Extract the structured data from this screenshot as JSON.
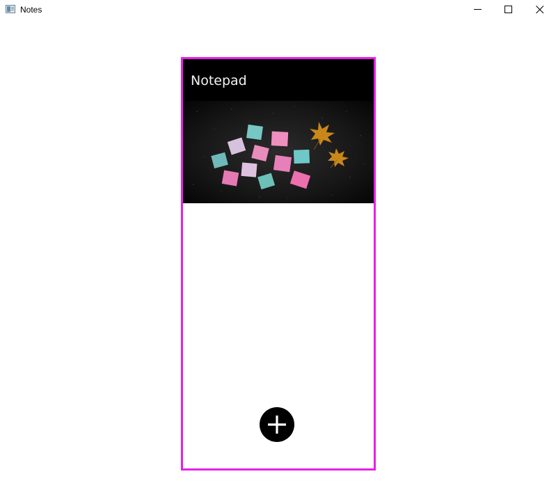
{
  "window": {
    "title": "Notes",
    "controls": {
      "minimize_icon": "minimize-icon",
      "maximize_icon": "maximize-icon",
      "close_icon": "close-icon"
    }
  },
  "app": {
    "header_title": "Notepad",
    "hero_image": "sticky-notes-on-dark-ground-photo",
    "fab_icon": "plus-icon",
    "colors": {
      "frame_border": "#e81ee8",
      "header_bg": "#000000",
      "header_text": "#f2f2f2",
      "fab_bg": "#000000",
      "fab_icon": "#ffffff"
    }
  }
}
